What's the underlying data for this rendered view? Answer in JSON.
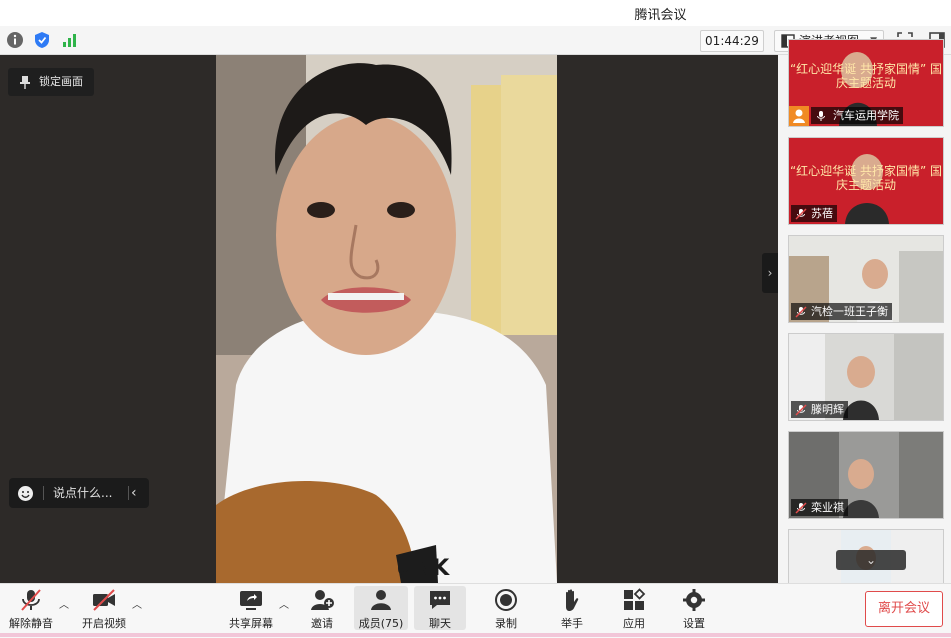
{
  "window": {
    "title": "腾讯会议"
  },
  "toolbar": {
    "info_icon": "info-icon",
    "security_icon": "shield-icon",
    "signal_icon": "signal-icon",
    "duration": "01:44:29",
    "view_mode": "演讲者视图",
    "fullscreen_icon": "fullscreen-icon",
    "sidebar_icon": "sidebar-toggle-icon"
  },
  "main": {
    "lock_label": "锁定画面",
    "chat_placeholder": "说点什么..."
  },
  "participants": [
    {
      "name": "汽车运用学院",
      "banner": "“红心迎华诞 共抒家国情” 国庆主题活动"
    },
    {
      "name": "苏蓓",
      "banner": "“红心迎华诞 共抒家国情” 国庆主题活动"
    },
    {
      "name": "汽检一班王子衡"
    },
    {
      "name": "滕明辉"
    },
    {
      "name": "栾业祺"
    },
    {
      "name": ""
    }
  ],
  "bottombar": {
    "unmute": "解除静音",
    "start_video": "开启视频",
    "share_screen": "共享屏幕",
    "invite": "邀请",
    "members": "成员(75)",
    "chat": "聊天",
    "record": "录制",
    "raise_hand": "举手",
    "apps": "应用",
    "settings": "设置",
    "leave": "离开会议"
  },
  "colors": {
    "accent_red": "#e04b4b",
    "banner_red": "#c9202b",
    "signal_green": "#2fb44a",
    "shield_blue": "#2f7bf5"
  }
}
